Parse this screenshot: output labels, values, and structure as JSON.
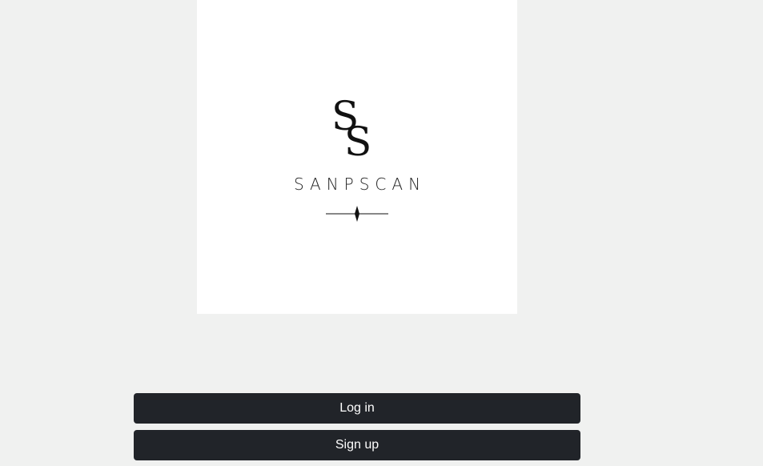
{
  "logo": {
    "monogram_icon": "ss-monogram-icon",
    "brand_name": "SANPSCAN",
    "ornament_icon": "diamond-divider-icon"
  },
  "actions": {
    "login_label": "Log in",
    "signup_label": "Sign up"
  },
  "colors": {
    "background": "#f0f1f0",
    "card": "#ffffff",
    "button": "#212429",
    "button_text": "#ffffff"
  }
}
